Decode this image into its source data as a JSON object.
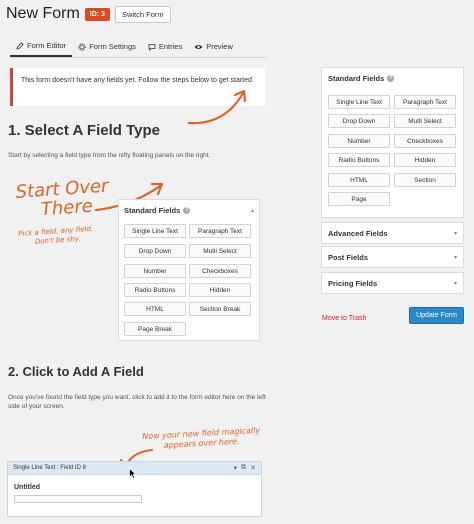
{
  "header": {
    "title": "New Form",
    "id_badge": "ID: 3",
    "switch_label": "Switch Form"
  },
  "tabs": [
    {
      "label": "Form Editor",
      "icon": "pencil-icon",
      "active": true
    },
    {
      "label": "Form Settings",
      "icon": "gear-icon",
      "active": false
    },
    {
      "label": "Entries",
      "icon": "speech-bubble-icon",
      "active": false
    },
    {
      "label": "Preview",
      "icon": "eye-icon",
      "active": false
    }
  ],
  "notice": {
    "text": "This form doesn't have any fields yet. Follow the steps below to get started."
  },
  "step1": {
    "heading": "1. Select A Field Type",
    "description": "Start by selecting a field type from the nifty floating panels on the right.",
    "hand_title_line1": "Start Over",
    "hand_title_line2": "There",
    "hand_sub_line1": "Pick a field, any field.",
    "hand_sub_line2": "Don't be shy."
  },
  "demo_panel": {
    "title": "Standard Fields",
    "buttons": [
      "Single Line Text",
      "Paragraph Text",
      "Drop Down",
      "Multi Select",
      "Number",
      "Checkboxes",
      "Radio Buttons",
      "Hidden",
      "HTML",
      "Section Break",
      "Page Break"
    ]
  },
  "sidebar": {
    "standard_fields": {
      "title": "Standard Fields",
      "buttons": [
        "Single Line Text",
        "Paragraph Text",
        "Drop Down",
        "Multi Select",
        "Number",
        "Checkboxes",
        "Radio Buttons",
        "Hidden",
        "HTML",
        "Section",
        "Page"
      ]
    },
    "sections": [
      {
        "label": "Advanced Fields"
      },
      {
        "label": "Post Fields"
      },
      {
        "label": "Pricing Fields"
      }
    ],
    "trash_label": "Move to Trash",
    "update_label": "Update Form"
  },
  "step2": {
    "heading": "2. Click to Add A Field",
    "description": "Once you've found the field type you want, click to add it to the form editor here on the left side of your screen.",
    "hand_note_line1": "Now your new field magically",
    "hand_note_line2": "appears over here.",
    "field_box": {
      "header": "Single Line Text : Field ID 8",
      "label": "Untitled"
    }
  },
  "colors": {
    "accent": "#dd6428",
    "badge": "#dd4a1f",
    "notice_border": "#dd3d36",
    "primary_button": "#2b89c9",
    "trash": "#cc2222"
  }
}
